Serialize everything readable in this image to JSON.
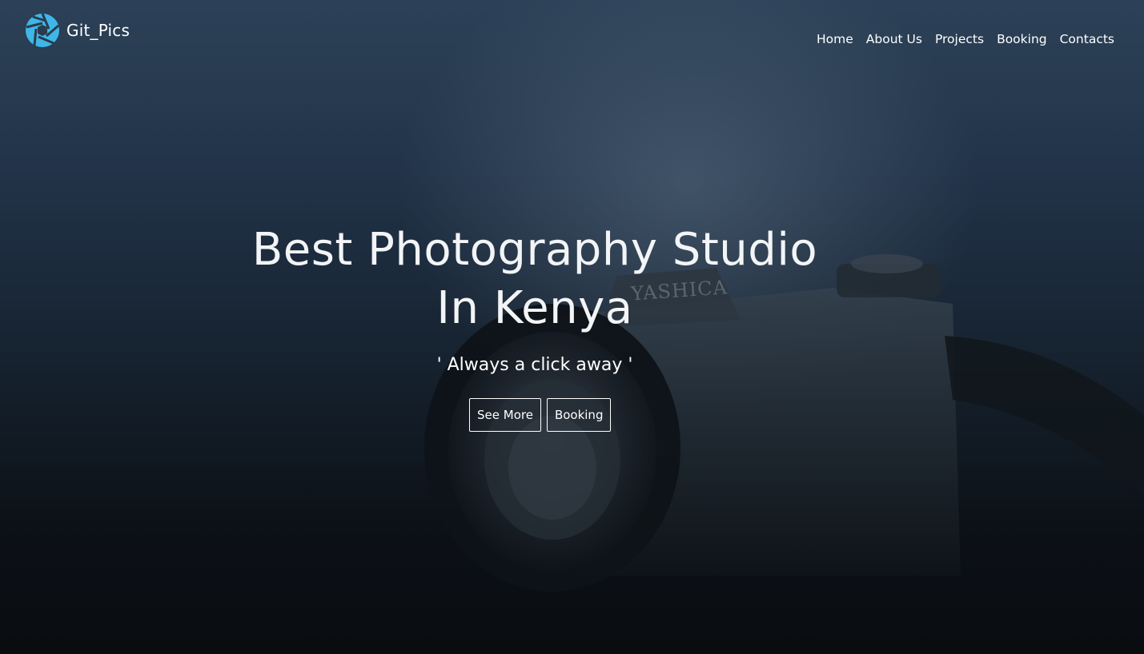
{
  "header": {
    "brand_name": "Git_Pics",
    "brand_color": "#3fb6e8",
    "nav": [
      {
        "label": "Home"
      },
      {
        "label": "About Us"
      },
      {
        "label": "Projects"
      },
      {
        "label": "Booking"
      },
      {
        "label": "Contacts"
      }
    ]
  },
  "hero": {
    "title_line1": "Best Photography Studio",
    "title_line2": "In Kenya",
    "tagline": "' Always a click away '",
    "buttons": {
      "see_more": "See More",
      "booking": "Booking"
    },
    "camera_brand": "YASHICA"
  },
  "colors": {
    "background_top": "#2c4157",
    "background_bottom": "#0a0c10",
    "text": "#ffffff",
    "accent": "#3fb6e8"
  },
  "icons": {
    "brand_logo": "camera-aperture-icon"
  }
}
